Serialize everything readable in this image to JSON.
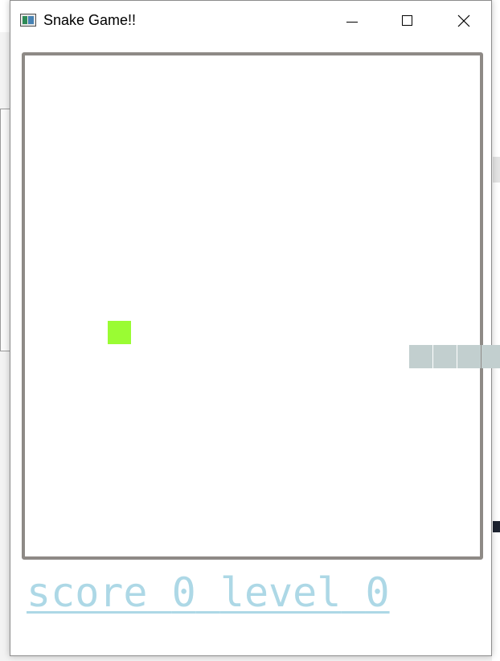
{
  "window": {
    "title": "Snake Game!!",
    "icon": "app-icon"
  },
  "controls": {
    "minimize_icon": "minimize-icon",
    "maximize_icon": "maximize-icon",
    "close_icon": "close-icon"
  },
  "game": {
    "board_border_color": "#8e8a86",
    "food_color": "#9afc33",
    "snake_color": "#c2cfcf",
    "snake_segments": 4
  },
  "hud": {
    "score_label": "score",
    "score": "0",
    "level_label": "level",
    "level": "0",
    "color": "#add8e6"
  }
}
